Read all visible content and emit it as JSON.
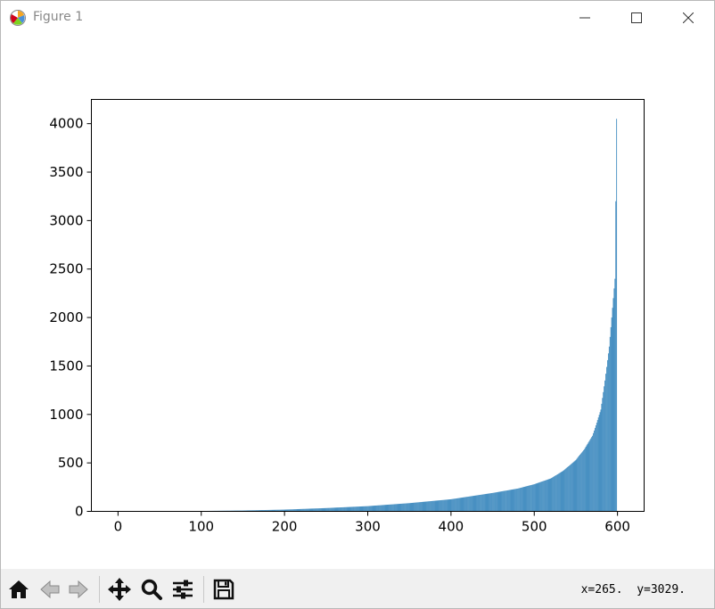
{
  "window": {
    "title": "Figure 1",
    "icons": {
      "app": "matplotlib-icon",
      "minimize": "minimize-icon",
      "maximize": "maximize-icon",
      "close": "close-icon"
    }
  },
  "toolbar": {
    "buttons": [
      {
        "name": "home-icon",
        "tooltip": "Reset original view"
      },
      {
        "name": "back-arrow-icon",
        "tooltip": "Back to previous view"
      },
      {
        "name": "forward-arrow-icon",
        "tooltip": "Forward to next view"
      },
      {
        "name": "pan-icon",
        "tooltip": "Pan axes"
      },
      {
        "name": "zoom-icon",
        "tooltip": "Zoom to rectangle"
      },
      {
        "name": "configure-subplots-icon",
        "tooltip": "Configure subplots"
      },
      {
        "name": "save-icon",
        "tooltip": "Save the figure"
      }
    ],
    "coords": "x=265.  y=3029."
  },
  "chart_data": {
    "type": "bar",
    "title": "",
    "xlabel": "",
    "ylabel": "",
    "xlim": [
      -32,
      632
    ],
    "ylim": [
      0,
      4250
    ],
    "xticks": [
      0,
      100,
      200,
      300,
      400,
      500,
      600
    ],
    "yticks": [
      0,
      500,
      1000,
      1500,
      2000,
      2500,
      3000,
      3500,
      4000
    ],
    "bar_color": "#1f77b4",
    "grid": false,
    "legend": "none",
    "curve": [
      [
        0,
        0
      ],
      [
        100,
        4
      ],
      [
        150,
        9
      ],
      [
        200,
        18
      ],
      [
        250,
        34
      ],
      [
        300,
        54
      ],
      [
        350,
        85
      ],
      [
        400,
        125
      ],
      [
        450,
        190
      ],
      [
        480,
        235
      ],
      [
        500,
        280
      ],
      [
        520,
        340
      ],
      [
        535,
        420
      ],
      [
        550,
        530
      ],
      [
        560,
        640
      ],
      [
        570,
        780
      ],
      [
        580,
        1050
      ],
      [
        585,
        1350
      ],
      [
        590,
        1700
      ],
      [
        593,
        2000
      ],
      [
        596,
        2300
      ],
      [
        597,
        2400
      ],
      [
        598,
        3200
      ],
      [
        599,
        4050
      ]
    ]
  }
}
